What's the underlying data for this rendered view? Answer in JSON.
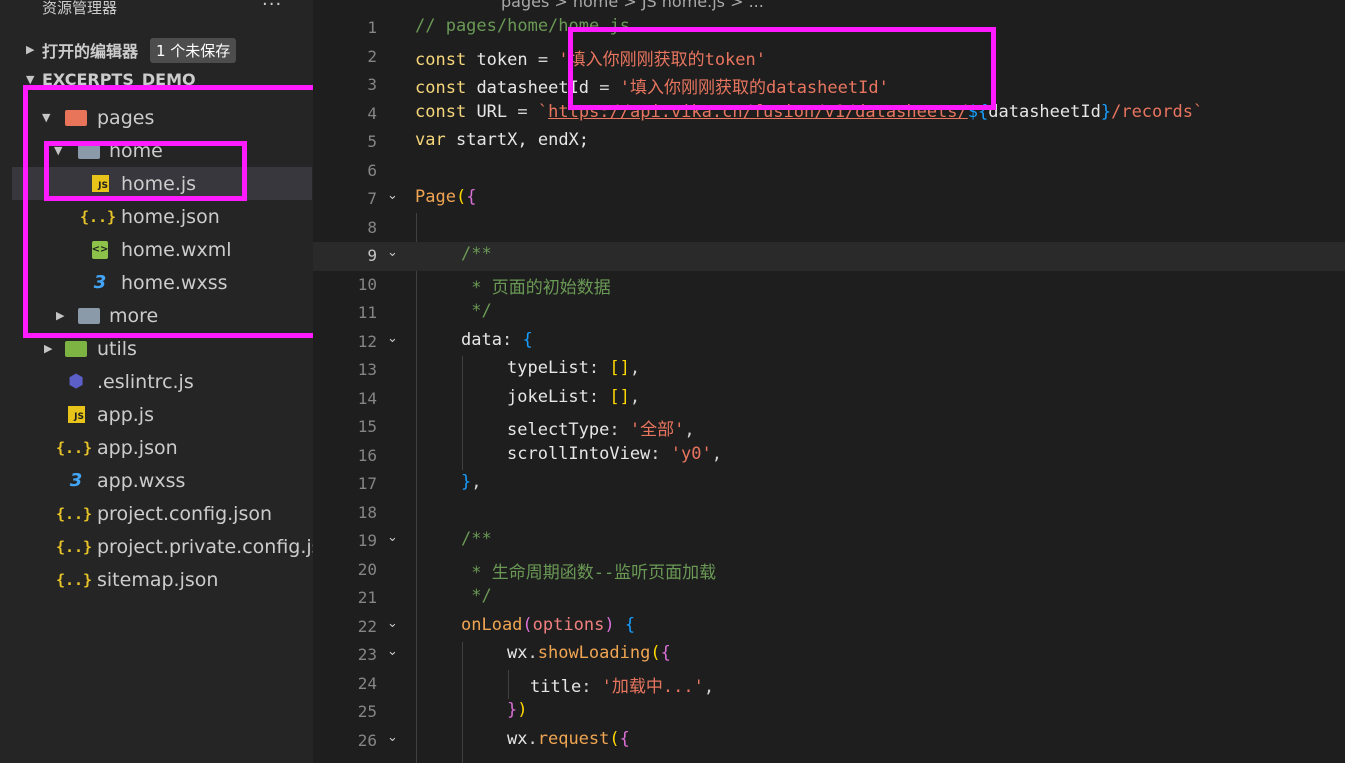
{
  "sidebar": {
    "title": "资源管理器",
    "more": "···",
    "open_editors": {
      "label": "打开的编辑器",
      "badge": "1 个未保存"
    },
    "project": "EXCERPTS_DEMO",
    "tree": [
      {
        "label": "pages"
      },
      {
        "label": "home"
      },
      {
        "label": "home.js"
      },
      {
        "label": "home.json"
      },
      {
        "label": "home.wxml"
      },
      {
        "label": "home.wxss"
      },
      {
        "label": "more"
      },
      {
        "label": "utils"
      },
      {
        "label": ".eslintrc.js"
      },
      {
        "label": "app.js"
      },
      {
        "label": "app.json"
      },
      {
        "label": "app.wxss"
      },
      {
        "label": "project.config.json"
      },
      {
        "label": "project.private.config.js..."
      },
      {
        "label": "sitemap.json"
      }
    ]
  },
  "editor": {
    "breadcrumb": "pages > home > JS home.js > ...",
    "lines": [
      {
        "n": "1"
      },
      {
        "n": "2"
      },
      {
        "n": "3"
      },
      {
        "n": "4"
      },
      {
        "n": "5"
      },
      {
        "n": "6"
      },
      {
        "n": "7"
      },
      {
        "n": "8"
      },
      {
        "n": "9"
      },
      {
        "n": "10"
      },
      {
        "n": "11"
      },
      {
        "n": "12"
      },
      {
        "n": "13"
      },
      {
        "n": "14"
      },
      {
        "n": "15"
      },
      {
        "n": "16"
      },
      {
        "n": "17"
      },
      {
        "n": "18"
      },
      {
        "n": "19"
      },
      {
        "n": "20"
      },
      {
        "n": "21"
      },
      {
        "n": "22"
      },
      {
        "n": "23"
      },
      {
        "n": "24"
      },
      {
        "n": "25"
      },
      {
        "n": "26"
      }
    ],
    "code": {
      "l1": "// pages/home/home.js",
      "l2_kw": "const",
      "l2_name": "token",
      "l2_str": "'填入你刚刚获取的token'",
      "l3_kw": "const",
      "l3_name": "datasheetId",
      "l3_str": "'填入你刚刚获取的datasheetId'",
      "l4_kw": "const",
      "l4_name": "URL",
      "l4_url": "https://api.vika.cn/fusion/v1/datasheets/",
      "l4_var": "datasheetId",
      "l4_tail": "/records",
      "l5_kw": "var",
      "l5_rest": "startX, endX;",
      "l7_fn": "Page",
      "l9": "/**",
      "l10": " * 页面的初始数据",
      "l11": " */",
      "l12_prop": "data",
      "l13_prop": "typeList",
      "l14_prop": "jokeList",
      "l15_prop": "selectType",
      "l15_str": "'全部'",
      "l16_prop": "scrollIntoView",
      "l16_str": "'y0'",
      "l19": "/**",
      "l20": " * 生命周期函数--监听页面加载",
      "l21": " */",
      "l22_fn": "onLoad",
      "l22_param": "options",
      "l23_obj": "wx",
      "l23_fn": "showLoading",
      "l24_prop": "title",
      "l24_str": "'加载中...'",
      "l26_obj": "wx",
      "l26_fn": "request"
    }
  },
  "colors": {
    "highlight": "#ff1aff",
    "string": "#e8755f",
    "comment": "#6a9955",
    "keyword": "#c586c0"
  },
  "icons": [
    "folder-icon",
    "js-file-icon",
    "json-file-icon",
    "wxml-file-icon",
    "wxss-file-icon",
    "eslint-icon",
    "chevron-right-icon",
    "chevron-down-icon",
    "fold-chevron-icon"
  ]
}
